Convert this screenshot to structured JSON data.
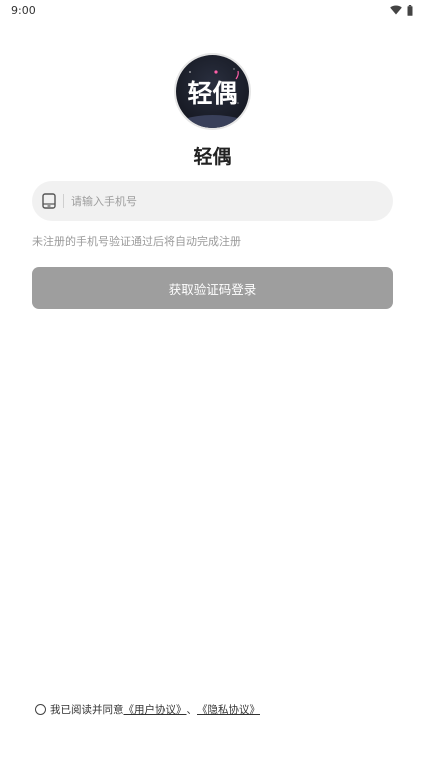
{
  "status_bar": {
    "time": "9:00",
    "icons": [
      "wifi-icon",
      "battery-icon"
    ]
  },
  "logo": {
    "text": "轻偶"
  },
  "app": {
    "name": "轻偶"
  },
  "phone_field": {
    "icon": "phone-icon",
    "placeholder": "请输入手机号",
    "value": ""
  },
  "hint": "未注册的手机号验证通过后将自动完成注册",
  "login_button": {
    "label": "获取验证码登录"
  },
  "agreement": {
    "prefix": "我已阅读并同意",
    "user_agreement": "《用户协议》",
    "separator": "、",
    "privacy_agreement": "《隐私协议》"
  },
  "colors": {
    "button_bg": "#9e9e9e",
    "input_bg": "#f1f1f1",
    "hint": "#9a9a9a",
    "logo_bg": "#1f2330"
  }
}
